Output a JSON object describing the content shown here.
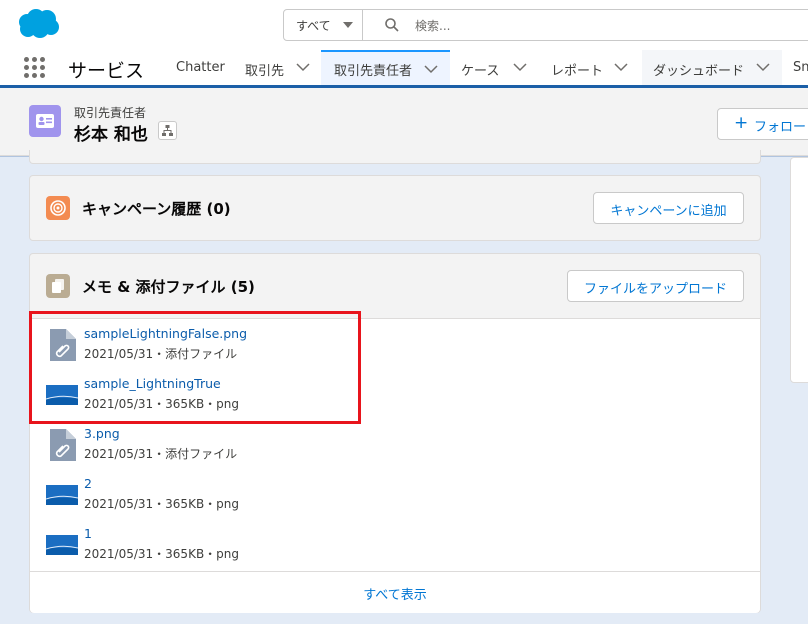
{
  "header": {
    "search_scope": "すべて",
    "search_placeholder": "検索...",
    "brand_color": "#00a1e0"
  },
  "nav": {
    "app_name": "サービス",
    "tabs": [
      {
        "label": "Chatter",
        "has_menu": false,
        "active": false
      },
      {
        "label": "取引先",
        "has_menu": true,
        "active": false
      },
      {
        "label": "取引先責任者",
        "has_menu": true,
        "active": true
      },
      {
        "label": "ケース",
        "has_menu": true,
        "active": false
      },
      {
        "label": "レポート",
        "has_menu": true,
        "active": false
      },
      {
        "label": "ダッシュボード",
        "has_menu": true,
        "active": false
      },
      {
        "label": "Sn",
        "has_menu": false,
        "active": false
      }
    ]
  },
  "record": {
    "object_label": "取引先責任者",
    "name": "杉本 和也",
    "follow_label": "フォロー"
  },
  "campaign": {
    "title": "キャンペーン履歴 (0)",
    "add_button": "キャンペーンに追加"
  },
  "files": {
    "title": "メモ & 添付ファイル (5)",
    "upload_button": "ファイルをアップロード",
    "items": [
      {
        "name": "sampleLightningFalse.png",
        "meta": "2021/05/31・添付ファイル",
        "icon": "attachment-file-icon"
      },
      {
        "name": "sample_LightningTrue",
        "meta": "2021/05/31・365KB・png",
        "icon": "image-thumbnail-icon"
      },
      {
        "name": "3.png",
        "meta": "2021/05/31・添付ファイル",
        "icon": "attachment-file-icon"
      },
      {
        "name": "2",
        "meta": "2021/05/31・365KB・png",
        "icon": "image-thumbnail-icon"
      },
      {
        "name": "1",
        "meta": "2021/05/31・365KB・png",
        "icon": "image-thumbnail-icon"
      }
    ],
    "view_all": "すべて表示"
  }
}
